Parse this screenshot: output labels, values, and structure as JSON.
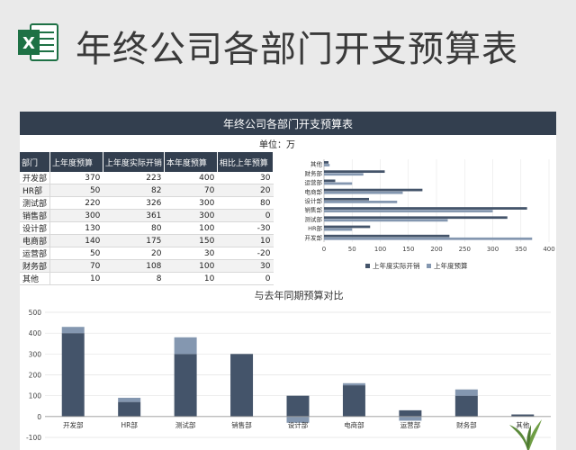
{
  "banner": {
    "title": "年终公司各部门开支预算表"
  },
  "sheet": {
    "header": "年终公司各部门开支预算表",
    "unit": "单位：万",
    "columns": [
      "部门",
      "上年度预算",
      "上年度实际开销",
      "本年度预算",
      "相比上年预算"
    ],
    "rows": [
      [
        "开发部",
        "370",
        "223",
        "400",
        "30"
      ],
      [
        "HR部",
        "50",
        "82",
        "70",
        "20"
      ],
      [
        "测试部",
        "220",
        "326",
        "300",
        "80"
      ],
      [
        "销售部",
        "300",
        "361",
        "300",
        "0"
      ],
      [
        "设计部",
        "130",
        "80",
        "100",
        "-30"
      ],
      [
        "电商部",
        "140",
        "175",
        "150",
        "10"
      ],
      [
        "运营部",
        "50",
        "20",
        "30",
        "-20"
      ],
      [
        "财务部",
        "70",
        "108",
        "100",
        "30"
      ],
      [
        "其他",
        "10",
        "8",
        "10",
        "0"
      ]
    ]
  },
  "colors": {
    "dark": "#44546a",
    "light": "#8497b0",
    "header": "#333f4f"
  },
  "chart_data": [
    {
      "type": "bar",
      "orientation": "horizontal",
      "categories": [
        "开发部",
        "HR部",
        "测试部",
        "销售部",
        "设计部",
        "电商部",
        "运营部",
        "财务部",
        "其他"
      ],
      "series": [
        {
          "name": "上年度实际开销",
          "values": [
            223,
            82,
            326,
            361,
            80,
            175,
            20,
            108,
            8
          ]
        },
        {
          "name": "上年度预算",
          "values": [
            370,
            50,
            220,
            300,
            130,
            140,
            50,
            70,
            10
          ]
        }
      ],
      "legend_labels": [
        "上年度实际开销",
        "上年度预算"
      ],
      "xlim": [
        0,
        400
      ],
      "xticks": [
        0,
        50,
        100,
        150,
        200,
        250,
        300,
        350,
        400
      ],
      "legend": "bottom"
    },
    {
      "type": "bar",
      "stacked": true,
      "title": "与去年同期预算对比",
      "categories": [
        "开发部",
        "HR部",
        "测试部",
        "销售部",
        "设计部",
        "电商部",
        "运营部",
        "财务部",
        "其他"
      ],
      "series": [
        {
          "values": [
            400,
            70,
            300,
            300,
            100,
            150,
            30,
            100,
            10
          ]
        },
        {
          "values": [
            30,
            20,
            80,
            0,
            -30,
            10,
            -20,
            30,
            0
          ]
        }
      ],
      "ylim": [
        -100,
        500
      ],
      "yticks": [
        -100,
        0,
        100,
        200,
        300,
        400,
        500
      ]
    }
  ]
}
